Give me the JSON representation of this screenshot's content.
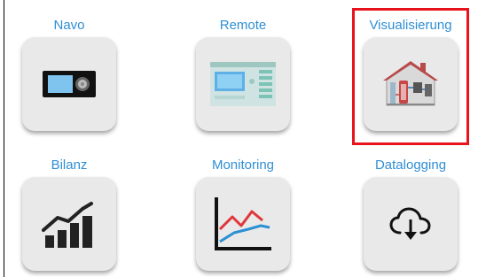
{
  "tiles": [
    {
      "label": "Navo",
      "icon": "controller-device-icon"
    },
    {
      "label": "Remote",
      "icon": "remote-panel-icon"
    },
    {
      "label": "Visualisierung",
      "icon": "house-visualization-icon"
    },
    {
      "label": "Bilanz",
      "icon": "rising-bars-icon"
    },
    {
      "label": "Monitoring",
      "icon": "line-chart-icon"
    },
    {
      "label": "Datalogging",
      "icon": "cloud-download-icon"
    }
  ],
  "highlight_color": "#e8141d",
  "label_color": "#2f8fd6"
}
